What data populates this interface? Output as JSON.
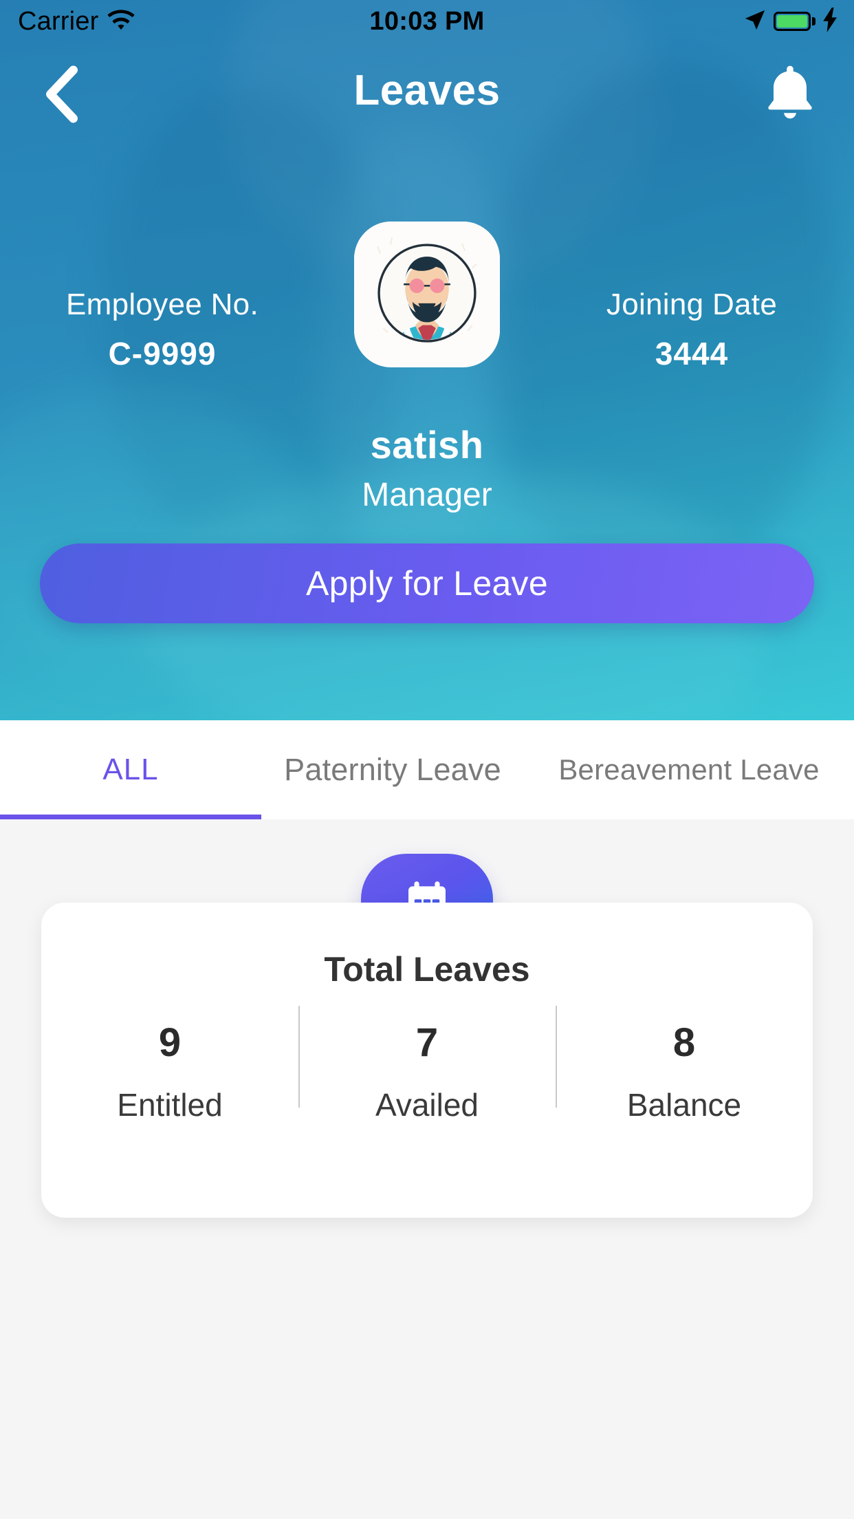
{
  "statusbar": {
    "carrier": "Carrier",
    "time": "10:03 PM",
    "wifi_icon": "wifi-icon",
    "location_icon": "location-arrow-icon",
    "battery_icon": "battery-icon",
    "charging_icon": "lightning-bolt-icon",
    "battery_color": "#4cd964"
  },
  "nav": {
    "title": "Leaves",
    "back_icon": "chevron-left-icon",
    "bell_icon": "bell-icon"
  },
  "profile": {
    "employee_label": "Employee No.",
    "employee_value": "C-9999",
    "joining_label": "Joining Date",
    "joining_value": "3444",
    "name": "satish",
    "role": "Manager",
    "avatar_icon": "user-avatar-illustration",
    "apply_button": "Apply for Leave"
  },
  "tabs": [
    {
      "label": "ALL",
      "active": true
    },
    {
      "label": "Paternity Leave",
      "active": false
    },
    {
      "label": "Bereavement Leave",
      "active": false
    }
  ],
  "leave_card": {
    "badge_icon": "calendar-icon",
    "title": "Total Leaves",
    "stats": [
      {
        "value": "9",
        "label": "Entitled"
      },
      {
        "value": "7",
        "label": "Availed"
      },
      {
        "value": "8",
        "label": "Balance"
      }
    ]
  },
  "colors": {
    "accent_purple": "#6b52e8",
    "hero_blue": "#1f7bb2",
    "hero_teal": "#30c4d4",
    "card_bg": "#ffffff",
    "page_bg": "#f5f5f6"
  }
}
